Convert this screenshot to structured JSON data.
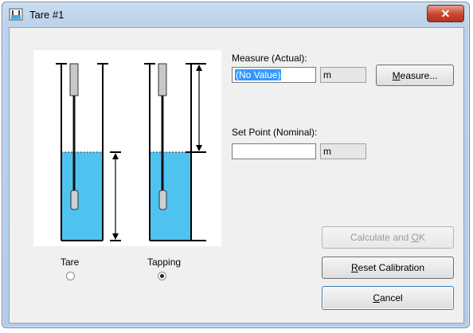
{
  "window": {
    "title": "Tare #1",
    "close_glyph": "✕"
  },
  "measure": {
    "label": "Measure (Actual):",
    "value": "(No Value)",
    "unit": "m",
    "button_label": "Measure...",
    "mnemonic": "M",
    "rest": "easure..."
  },
  "setpoint": {
    "label": "Set Point (Nominal):",
    "value": "",
    "unit": "m"
  },
  "buttons": {
    "calculate": {
      "label": "Calculate and OK",
      "pre": "Calculate and ",
      "mnemonic": "O",
      "post": "K",
      "enabled": false
    },
    "reset": {
      "label": "Reset Calibration",
      "mnemonic": "R",
      "post": "eset Calibration"
    },
    "cancel": {
      "label": "Cancel",
      "mnemonic": "C",
      "post": "ancel"
    }
  },
  "modes": [
    {
      "label": "Tare",
      "selected": false
    },
    {
      "label": "Tapping",
      "selected": true
    }
  ],
  "colors": {
    "liquid": "#4fc3f0",
    "title_bg": "#bcd2ea",
    "close_red": "#c8442f"
  }
}
